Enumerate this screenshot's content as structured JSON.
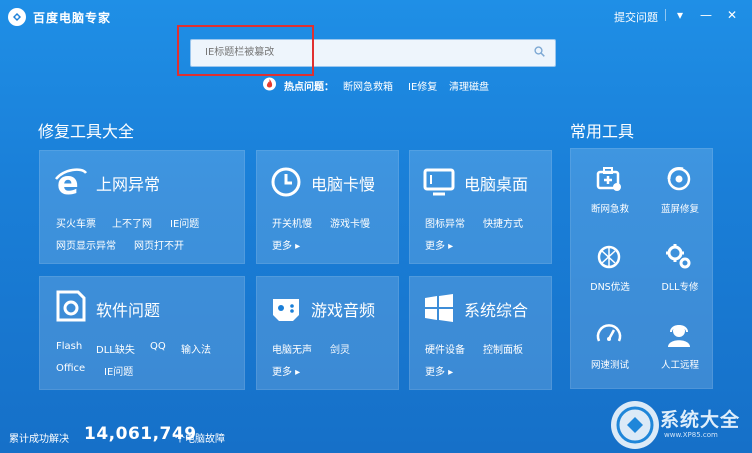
{
  "window": {
    "title": "百度电脑专家",
    "feedback": "提交问题",
    "menu": "▾",
    "minimize": "—",
    "close": "✕"
  },
  "search": {
    "value": "",
    "placeholder": "IE标题栏被篡改"
  },
  "hot": {
    "label": "热点问题：",
    "links": [
      "断网急救箱",
      "IE修复",
      "清理磁盘"
    ]
  },
  "repair": {
    "title": "修复工具大全",
    "cards": [
      {
        "title": "上网异常",
        "links": [
          "买火车票",
          "上不了网",
          "IE问题",
          "网页显示异常",
          "网页打不开"
        ]
      },
      {
        "title": "电脑卡慢",
        "links": [
          "开关机慢",
          "游戏卡慢"
        ],
        "more": "更多 ▸"
      },
      {
        "title": "电脑桌面",
        "links": [
          "图标异常",
          "快捷方式"
        ],
        "more": "更多 ▸"
      },
      {
        "title": "软件问题",
        "links": [
          "Flash",
          "DLL缺失",
          "QQ",
          "输入法",
          "Office",
          "IE问题"
        ]
      },
      {
        "title": "游戏音频",
        "links": [
          "电脑无声",
          "剑灵"
        ],
        "more": "更多 ▸"
      },
      {
        "title": "系统综合",
        "links": [
          "硬件设备",
          "控制面板"
        ],
        "more": "更多 ▸"
      }
    ]
  },
  "tools": {
    "title": "常用工具",
    "items": [
      "断网急救",
      "蓝屏修复",
      "DNS优选",
      "DLL专修",
      "网速测试",
      "人工远程"
    ]
  },
  "footer": {
    "label": "累计成功解决",
    "count": "14,061,749",
    "suffix": "个电脑故障"
  },
  "watermark": {
    "text": "系统大全",
    "url": "www.XP85.com"
  }
}
